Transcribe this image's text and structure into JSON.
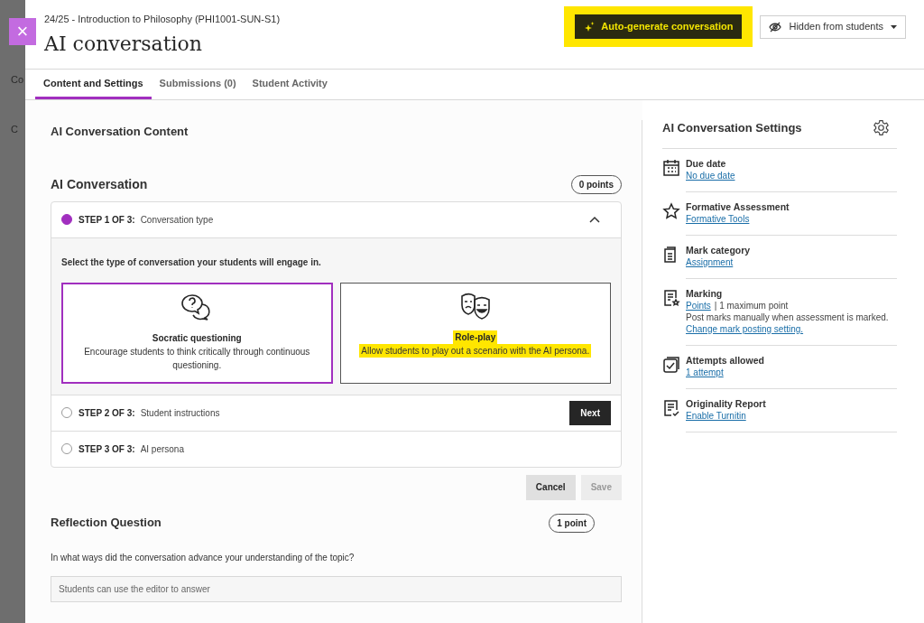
{
  "background_page": {
    "fragments": [
      "Co",
      "C"
    ]
  },
  "header": {
    "course": "24/25 - Introduction to Philosophy (PHI1001-SUN-S1)",
    "title": "AI conversation",
    "close_label": "×",
    "auto_generate": {
      "label": "Auto-generate conversation",
      "highlighted": true
    },
    "visibility": {
      "label": "Hidden from students"
    }
  },
  "tabs": [
    {
      "label": "Content and Settings",
      "selected": true
    },
    {
      "label": "Submissions (0)",
      "selected": false
    },
    {
      "label": "Student Activity",
      "selected": false
    }
  ],
  "content": {
    "title": "AI Conversation Content",
    "conversation": {
      "title": "AI Conversation",
      "points": "0 points",
      "steps": [
        {
          "step": "STEP 1 OF 3:",
          "name": "Conversation type",
          "active": true
        },
        {
          "step": "STEP 2 OF 3:",
          "name": "Student instructions",
          "active": false,
          "action": "Next"
        },
        {
          "step": "STEP 3 OF 3:",
          "name": "AI persona",
          "active": false
        }
      ],
      "prompt": "Select the type of conversation your students will engage in.",
      "options": [
        {
          "kind": "socratic",
          "title": "Socratic questioning",
          "description": "Encourage students to think critically through continuous questioning.",
          "selected": true,
          "highlighted": false
        },
        {
          "kind": "roleplay",
          "title": "Role-play",
          "description": "Allow students to play out a scenario with the AI persona.",
          "selected": false,
          "highlighted": true
        }
      ],
      "buttons": [
        {
          "label": "Cancel",
          "disabled": false
        },
        {
          "label": "Save",
          "disabled": true
        }
      ]
    },
    "reflection": {
      "title": "Reflection Question",
      "points": "1 point",
      "question": "In what ways did the conversation advance your understanding of the topic?",
      "placeholder": "Students can use the editor to answer"
    }
  },
  "settings": {
    "title": "AI Conversation Settings",
    "items": [
      {
        "kind": "calendar",
        "label": "Due date",
        "link": "No due date"
      },
      {
        "kind": "star",
        "label": "Formative Assessment",
        "link": "Formative Tools"
      },
      {
        "kind": "document",
        "label": "Mark category",
        "link": "Assignment"
      },
      {
        "kind": "marking",
        "label": "Marking",
        "link": "Points",
        "text": "| 1 maximum point",
        "note": "Post marks manually when assessment is marked.",
        "note_link": "Change mark posting setting."
      },
      {
        "kind": "attempts",
        "label": "Attempts allowed",
        "link": "1 attempt"
      },
      {
        "kind": "report",
        "label": "Originality Report",
        "link": "Enable Turnitin"
      }
    ]
  }
}
